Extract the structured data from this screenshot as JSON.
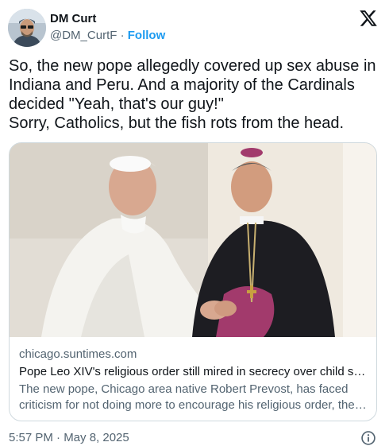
{
  "author": {
    "display_name": "DM Curt",
    "handle": "@DM_CurtF",
    "separator": "·",
    "follow_label": "Follow",
    "avatar_icon": "avatar-icon"
  },
  "brand": {
    "logo_icon": "x-logo-icon"
  },
  "tweet": {
    "text": "So, the new pope allegedly covered up sex abuse in Indiana and Peru. And a majority of the Cardinals decided \"Yeah, that's our guy!\"\nSorry, Catholics, but the fish rots from the head."
  },
  "link_card": {
    "domain": "chicago.suntimes.com",
    "title": "Pope Leo XIV's religious order still mired in secrecy over child sex abuse",
    "description": "The new pope, Chicago area native Robert Prevost, has faced criticism for not doing more to encourage his religious order, the Augustinians, to be more transparent."
  },
  "footer": {
    "timestamp": "5:57 PM · May 8, 2025",
    "info_icon": "info-icon"
  },
  "colors": {
    "accent": "#1d9bf0",
    "secondary_text": "#536471",
    "border": "#cfd9de"
  }
}
